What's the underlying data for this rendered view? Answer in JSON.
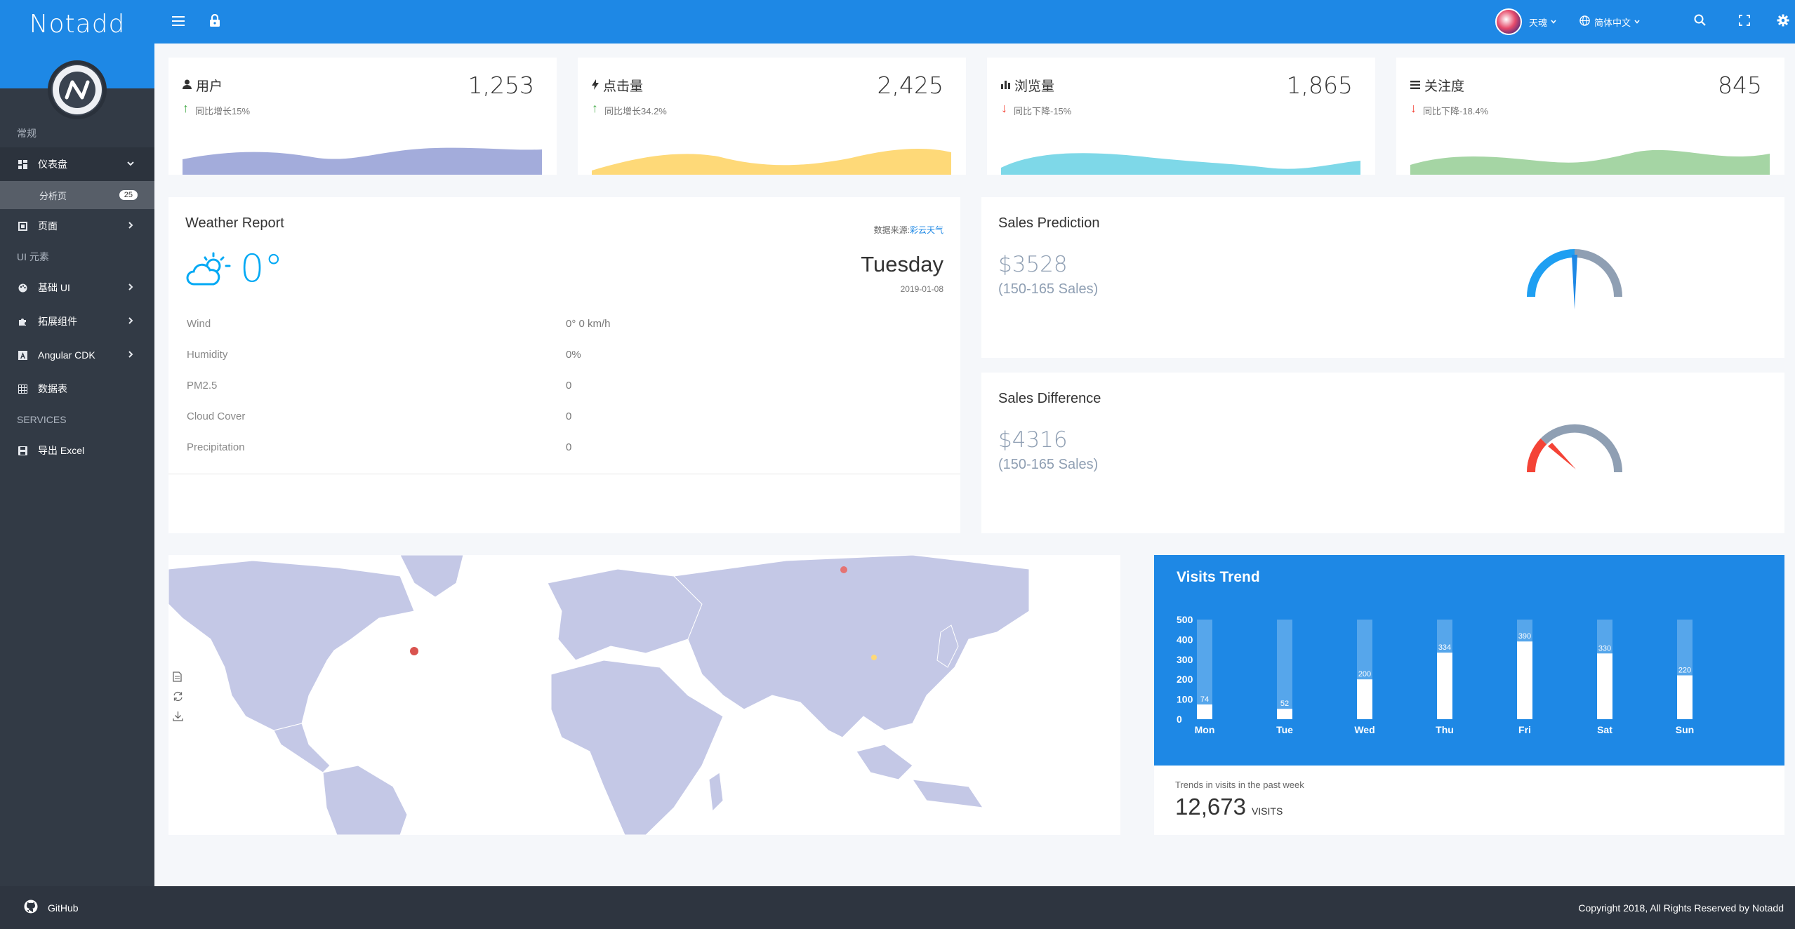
{
  "brand": {
    "name": "Notadd"
  },
  "sidebar": {
    "groups": [
      "常规",
      "UI 元素",
      "SERVICES"
    ],
    "items": [
      {
        "label": "仪表盘",
        "icon": "dashboard-icon"
      },
      {
        "label": "分析页",
        "badge": "25"
      },
      {
        "label": "页面",
        "icon": "layers-icon"
      },
      {
        "label": "基础 UI",
        "icon": "palette-icon"
      },
      {
        "label": "拓展组件",
        "icon": "puzzle-icon"
      },
      {
        "label": "Angular CDK",
        "icon": "angular-icon"
      },
      {
        "label": "数据表",
        "icon": "table-icon"
      },
      {
        "label": "导出 Excel",
        "icon": "save-icon"
      }
    ]
  },
  "header": {
    "user_name": "天魂",
    "language": "简体中文"
  },
  "stats": [
    {
      "title": "用户",
      "icon": "user-icon",
      "value": "1,253",
      "trend": "同比增长15%",
      "direction": "up",
      "color": "#a3acdb"
    },
    {
      "title": "点击量",
      "icon": "bolt-icon",
      "value": "2,425",
      "trend": "同比增长34.2%",
      "direction": "up",
      "color": "#fed978"
    },
    {
      "title": "浏览量",
      "icon": "bar-chart-icon",
      "value": "1,865",
      "trend": "同比下降-15%",
      "direction": "down",
      "color": "#7ed8e8"
    },
    {
      "title": "关注度",
      "icon": "list-icon",
      "value": "845",
      "trend": "同比下降-18.4%",
      "direction": "down",
      "color": "#a5d5a4"
    }
  ],
  "weather": {
    "title": "Weather Report",
    "source_label": "数据来源:",
    "source_link": "彩云天气",
    "temperature": "0°",
    "day": "Tuesday",
    "date": "2019-01-08",
    "rows": [
      {
        "label": "Wind",
        "value": "0° 0 km/h"
      },
      {
        "label": "Humidity",
        "value": "0%"
      },
      {
        "label": "PM2.5",
        "value": "0"
      },
      {
        "label": "Cloud Cover",
        "value": "0"
      },
      {
        "label": "Precipitation",
        "value": "0"
      }
    ]
  },
  "sales_prediction": {
    "title": "Sales Prediction",
    "amount": "$3528",
    "sub": "(150-165 Sales)",
    "gauge_fraction": 0.5
  },
  "sales_difference": {
    "title": "Sales Difference",
    "amount": "$4316",
    "sub": "(150-165 Sales)",
    "gauge_fraction": 0.25
  },
  "visits": {
    "title": "Visits Trend",
    "caption": "Trends in visits in the past week",
    "total": "12,673",
    "unit": "VISITS"
  },
  "chart_data": {
    "type": "bar",
    "title": "Visits Trend",
    "categories": [
      "Mon",
      "Tue",
      "Wed",
      "Thu",
      "Fri",
      "Sat",
      "Sun"
    ],
    "values": [
      74,
      52,
      200,
      334,
      390,
      330,
      220
    ],
    "ylim": [
      0,
      500
    ],
    "yticks": [
      500,
      400,
      300,
      200,
      100,
      0
    ]
  },
  "footer": {
    "github": "GitHub",
    "copyright": "Copyright 2018, All Rights Reserved by Notadd"
  }
}
